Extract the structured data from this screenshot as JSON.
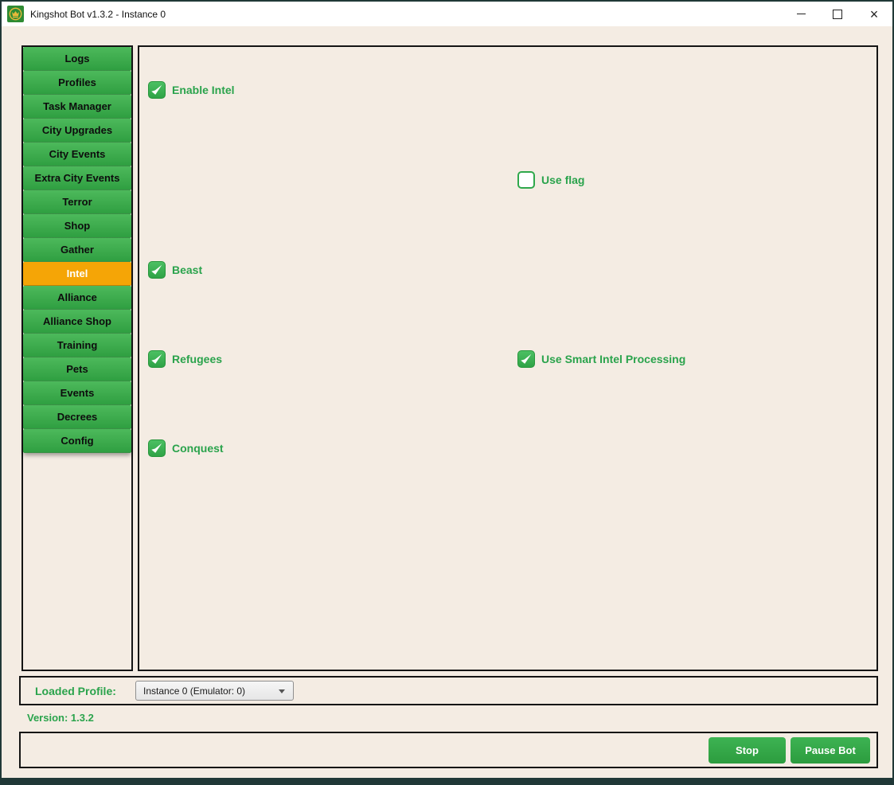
{
  "window": {
    "title": "Kingshot Bot v1.3.2 - Instance 0"
  },
  "icons": {
    "close": "×",
    "app": "crown-icon",
    "minimize": "minimize-line",
    "maximize": "square-outline",
    "dropdown": "caret-down"
  },
  "sidebar": {
    "items": [
      {
        "label": "Logs",
        "active": false
      },
      {
        "label": "Profiles",
        "active": false
      },
      {
        "label": "Task Manager",
        "active": false
      },
      {
        "label": "City Upgrades",
        "active": false
      },
      {
        "label": "City Events",
        "active": false
      },
      {
        "label": "Extra City Events",
        "active": false
      },
      {
        "label": "Terror",
        "active": false
      },
      {
        "label": "Shop",
        "active": false
      },
      {
        "label": "Gather",
        "active": false
      },
      {
        "label": "Intel",
        "active": true
      },
      {
        "label": "Alliance",
        "active": false
      },
      {
        "label": "Alliance Shop",
        "active": false
      },
      {
        "label": "Training",
        "active": false
      },
      {
        "label": "Pets",
        "active": false
      },
      {
        "label": "Events",
        "active": false
      },
      {
        "label": "Decrees",
        "active": false
      },
      {
        "label": "Config",
        "active": false
      }
    ]
  },
  "intel_panel": {
    "checkboxes": [
      {
        "label": "Enable Intel",
        "checked": true
      },
      {
        "label": "Use flag",
        "checked": false
      },
      {
        "label": "Beast",
        "checked": true
      },
      {
        "label": "Refugees",
        "checked": true
      },
      {
        "label": "Use Smart Intel Processing",
        "checked": true
      },
      {
        "label": "Conquest",
        "checked": true
      }
    ]
  },
  "footer": {
    "loaded_profile_label": "Loaded Profile:",
    "profile_value": "Instance 0 (Emulator: 0)",
    "version": "Version: 1.3.2",
    "stop_button": "Stop",
    "pause_button": "Pause Bot"
  },
  "colors": {
    "green_button": "#3aa84a",
    "active_tab_orange": "#f5a506",
    "accent_green_text": "#2aa34c",
    "background_cream": "#f4ece3",
    "window_border": "#203837",
    "panel_border": "#141414",
    "titlebar_bg": "#ffffff"
  }
}
